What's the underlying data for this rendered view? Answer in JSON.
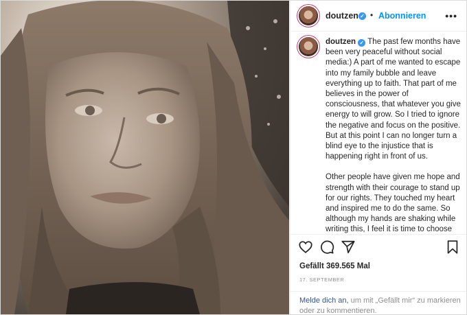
{
  "post": {
    "username": "doutzen",
    "follow_label": "Abonnieren",
    "separator": "•",
    "more_label": "•••",
    "caption": {
      "username": "doutzen",
      "paragraph1": "The past few months have been very peaceful without social media:) A part of me wanted to escape into my family bubble and leave everything up to faith. That part of me believes in the power of consciousness, that whatever you give energy to will grow. So I tried to ignore the negative and focus on the positive. But at this point I can no longer turn a blind eye to the injustice that is happening right in front of us.",
      "paragraph2": "Other people have given me hope and strength with their courage to stand up for our rights. They touched my heart and inspired me to do the same. So although my hands are shaking while writing this, I feel it is time to choose courage over comfort and speak my truth."
    },
    "likes": "Gefällt 369.565 Mal",
    "date": "17. SEPTEMBER",
    "login_prompt": {
      "link": "Melde dich an,",
      "rest": " um mit „Gefällt mir“ zu markieren oder zu kommentieren."
    }
  },
  "icons": {
    "like": "heart-outline-icon",
    "comment": "comment-bubble-icon",
    "share": "paper-plane-icon",
    "save": "bookmark-icon",
    "verified": "verified-badge-icon"
  },
  "colors": {
    "link": "#0095f6",
    "login_link": "#385185",
    "verified": "#3897f0",
    "muted": "#8e8e8e",
    "text": "#262626"
  }
}
